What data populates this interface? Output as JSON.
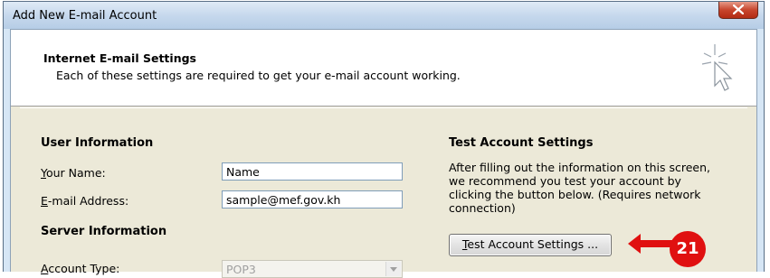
{
  "window": {
    "title": "Add New E-mail Account"
  },
  "header": {
    "title": "Internet E-mail Settings",
    "subtitle": "Each of these settings are required to get your e-mail account working."
  },
  "user_info": {
    "heading": "User Information",
    "name_label_accel": "Y",
    "name_label_rest": "our Name:",
    "name_value": "Name",
    "email_label_accel": "E",
    "email_label_rest": "-mail Address:",
    "email_value": "sample@mef.gov.kh"
  },
  "server_info": {
    "heading": "Server Information",
    "account_type_label_accel": "A",
    "account_type_label_rest": "ccount Type:",
    "account_type_value": "POP3"
  },
  "test_settings": {
    "heading": "Test Account Settings",
    "description": "After filling out the information on this screen, we recommend you test your account by clicking the button below. (Requires network connection)",
    "button_accel": "T",
    "button_rest": "est Account Settings ..."
  },
  "annotation": {
    "badge_number": "21",
    "color": "#e01010"
  },
  "icons": {
    "close": "close-icon",
    "header": "cursor-sparkle-icon",
    "dropdown": "chevron-down-icon",
    "pointer": "red-arrow-icon"
  }
}
